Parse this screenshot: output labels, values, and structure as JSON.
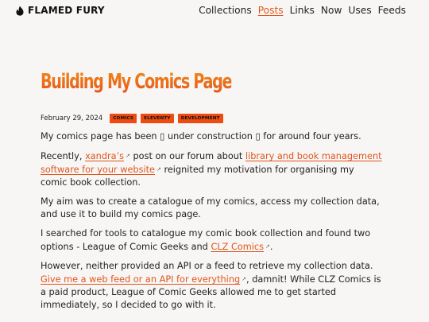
{
  "header": {
    "brand": "FLAMED FURY",
    "nav": [
      {
        "label": "Collections",
        "active": false
      },
      {
        "label": "Posts",
        "active": true
      },
      {
        "label": "Links",
        "active": false
      },
      {
        "label": "Now",
        "active": false
      },
      {
        "label": "Uses",
        "active": false
      },
      {
        "label": "Feeds",
        "active": false
      }
    ]
  },
  "post": {
    "title": "Building My Comics Page",
    "date": "February 29, 2024",
    "tags": [
      "COMICS",
      "ELEVENTY",
      "DEVELOPMENT"
    ],
    "p1": "My comics page has been ▯ under construction ▯ for around four years.",
    "p2_a": "Recently, ",
    "p2_link1": "xandra’s",
    "p2_b": " post on our forum about ",
    "p2_link2": "library and book management software for your website",
    "p2_c": " reignited my motivation for organising my comic book collection.",
    "p3": "My aim was to create a catalogue of my comics, access my collection data, and use it to build my comics page.",
    "p4_a": "I searched for tools to catalogue my comic book collection and found two options - League of Comic Geeks and ",
    "p4_link": "CLZ Comics",
    "p4_b": ".",
    "p5_a": "However, neither provided an API or a feed to retrieve my collection data. ",
    "p5_link": "Give me a web feed or an API for everything",
    "p5_b": ", damnit! While CLZ Comics is a paid product, League of Comic Geeks allowed me to get started immediately, so I decided to go with it.",
    "ext_icon": "↗"
  },
  "colors": {
    "accent": "#e05a1f",
    "tag_bg": "#ee4b12",
    "background": "#f8f6f4"
  }
}
